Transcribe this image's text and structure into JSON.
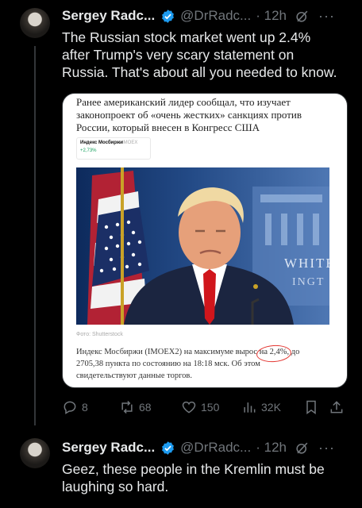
{
  "tweets": [
    {
      "name": "Sergey Radc...",
      "handle": "@DrRadc...",
      "time": "· 12h",
      "text_lines": [
        "The Russian stock market went up 2.4%",
        "after Trump's very scary statement on",
        "Russia. That's about all you needed to know."
      ],
      "card": {
        "headline_lines": [
          "Ранее американский лидер сообщал, что изучает",
          "законопроект об «очень жестких» санкциях против",
          "России, который внесен в Конгресс США"
        ],
        "widget": {
          "name": "Индекс Мосбиржи",
          "ticker": "IMOEX",
          "change": "+2,73%"
        },
        "photo_sign": "WHITE",
        "photo_sign2": "INGT",
        "photo_credit": "Фото: Shutterstock",
        "body_pre": "Индекс Мосбиржи (IMOEX2) на максимуме вырос ",
        "body_highlight": "на 2,4%",
        "body_post": ", до",
        "body_line2": "2705,38 пункта по состоянию на 18:18 мск. Об этом",
        "body_line3": "свидетельствуют данные торгов."
      },
      "actions": {
        "replies": "8",
        "reposts": "68",
        "likes": "150",
        "views": "32K"
      }
    },
    {
      "name": "Sergey Radc...",
      "handle": "@DrRadc...",
      "time": "· 12h",
      "text_lines": [
        "Geez, these people in the Kremlin must be",
        "laughing so hard."
      ]
    }
  ],
  "colors": {
    "background": "#000000",
    "text": "#e7e9ea",
    "muted": "#71767b",
    "verified": "#1d9bf0",
    "circle": "#e3342f"
  },
  "icons": [
    "verified-badge-icon",
    "grok-icon",
    "more-icon",
    "reply-icon",
    "repost-icon",
    "like-icon",
    "views-icon",
    "bookmark-icon",
    "share-icon"
  ]
}
